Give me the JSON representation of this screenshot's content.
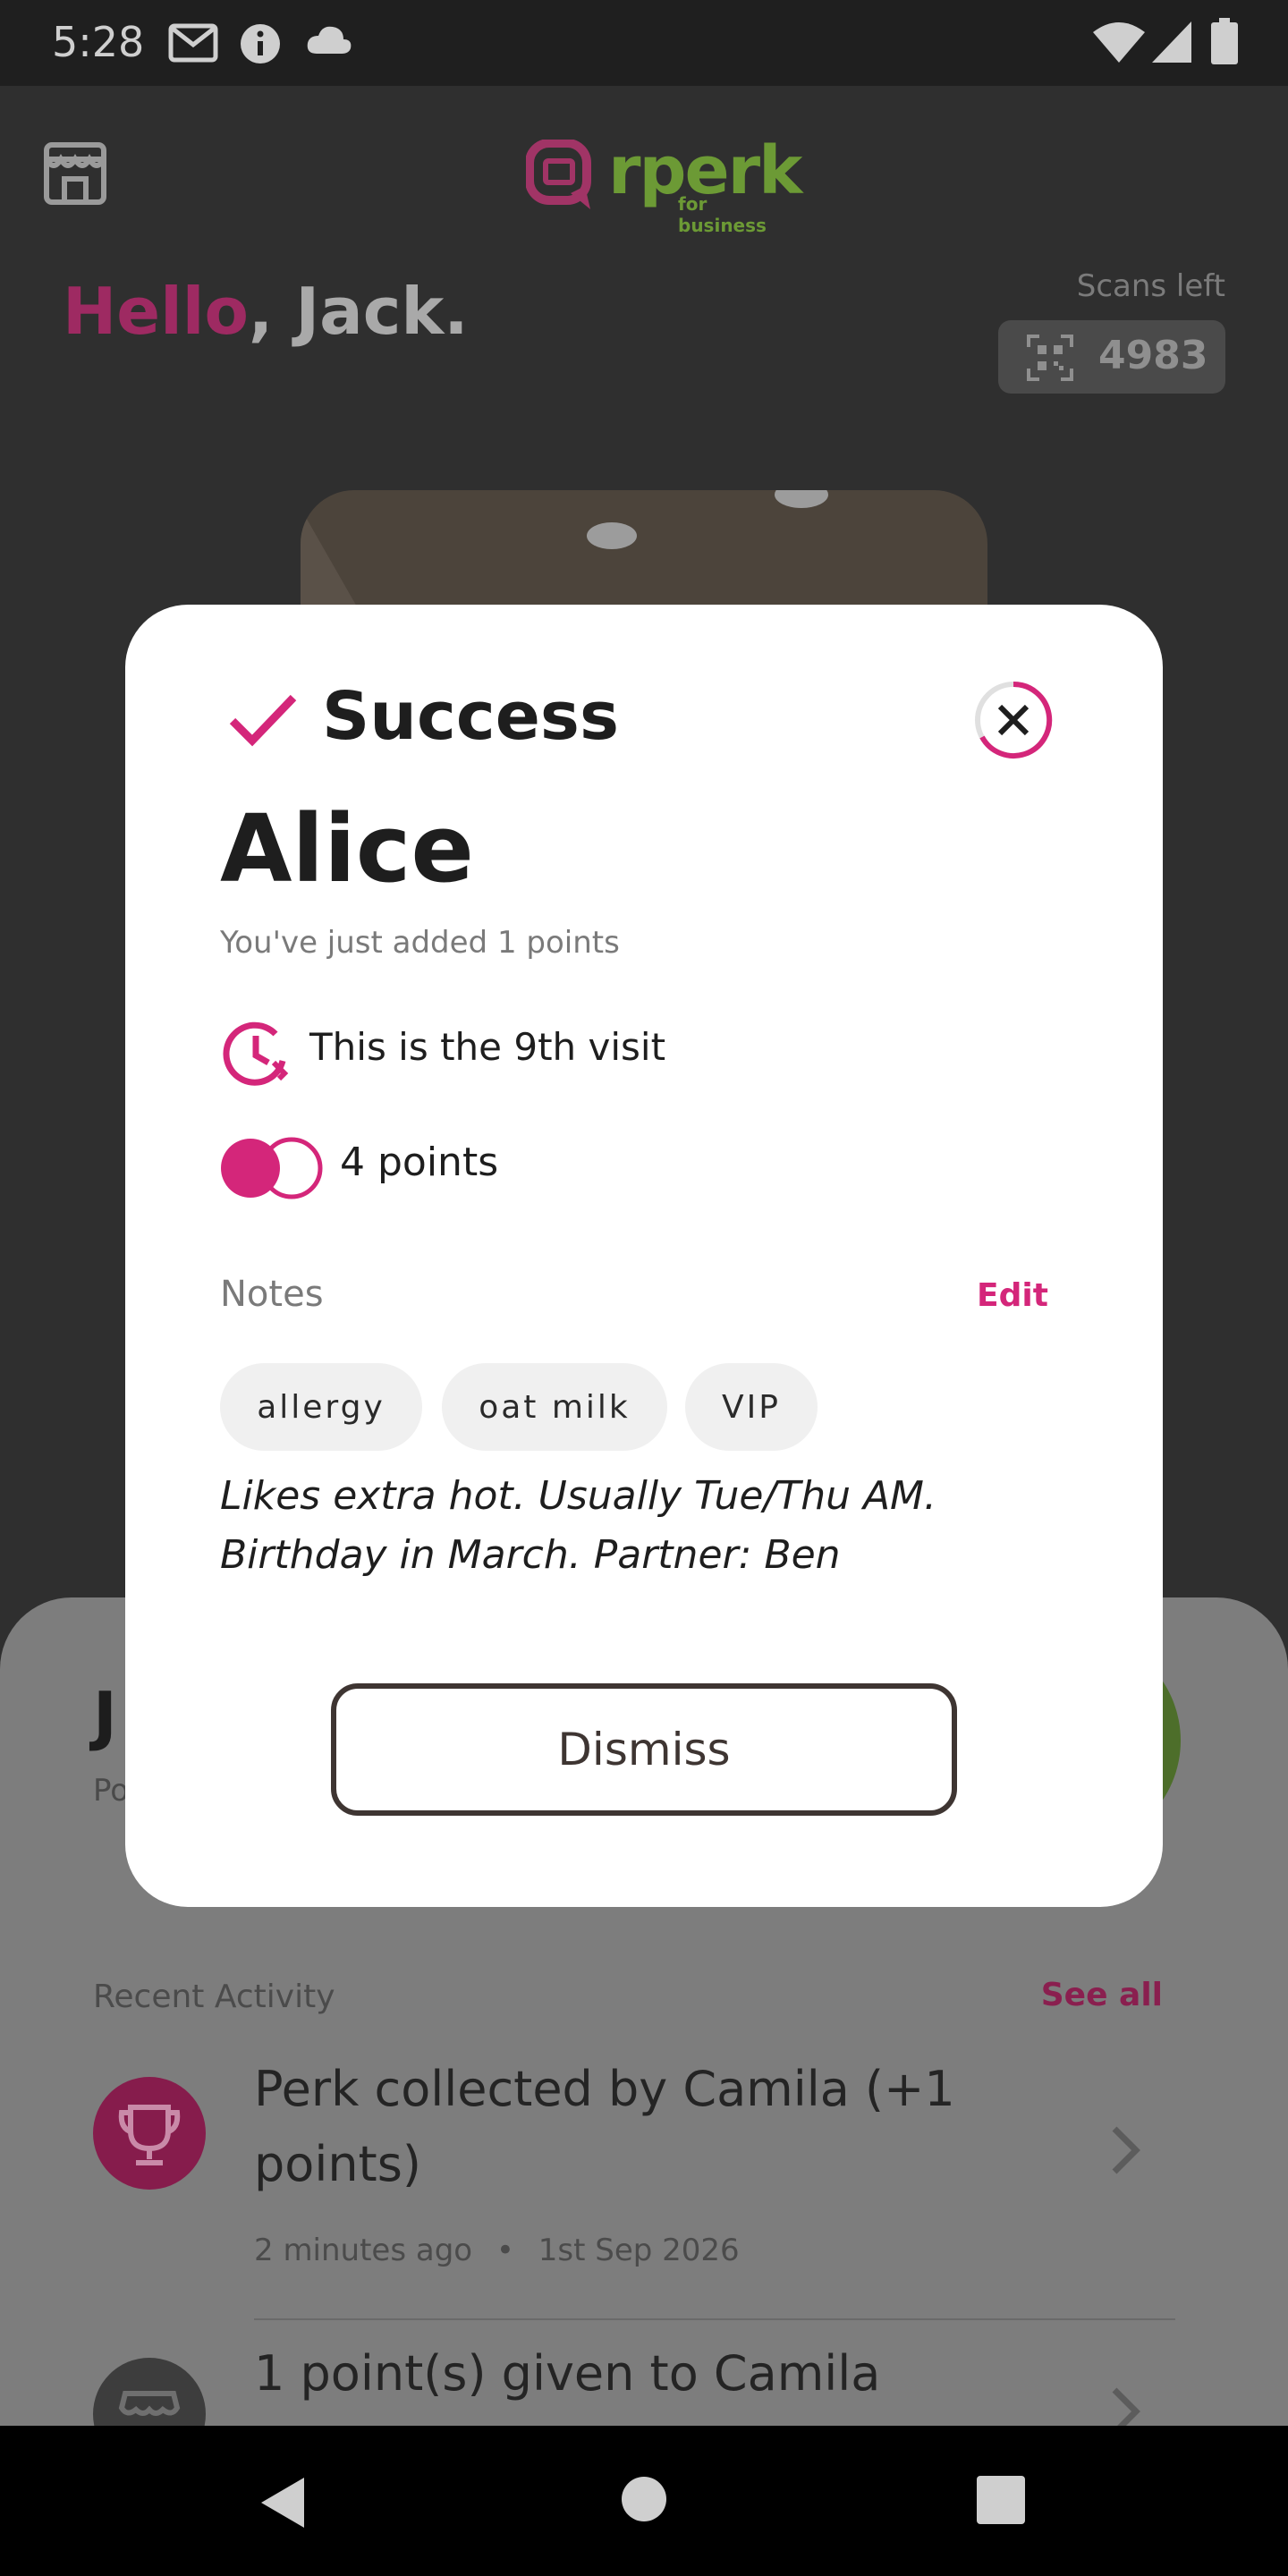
{
  "status_bar": {
    "time": "5:28",
    "icons": [
      "gmail-icon",
      "info-icon",
      "cloud-icon",
      "wifi-icon",
      "signal-icon",
      "battery-icon"
    ]
  },
  "header": {
    "logo_word": "rperk",
    "logo_sub": "for business",
    "greeting_hello": "Hello",
    "greeting_rest": ", Jack.",
    "scans_label": "Scans left",
    "scans_count": "4983"
  },
  "sheet": {
    "user_initial": "J",
    "user_sub": "Po",
    "recent_label": "Recent Activity",
    "see_all": "See all",
    "activities": [
      {
        "title": "Perk collected by Camila (+1 points)",
        "time": "2 minutes ago",
        "date": "1st Sep 2026",
        "icon": "trophy-icon"
      },
      {
        "title": "1 point(s) given to Camila",
        "icon": "store-icon"
      }
    ]
  },
  "modal": {
    "title": "Success",
    "name": "Alice",
    "added_text": "You've just added 1 points",
    "visit_text": "This is the 9th visit",
    "points_text": "4 points",
    "notes_label": "Notes",
    "edit_label": "Edit",
    "tags": [
      "allergy",
      "oat milk",
      "VIP"
    ],
    "notes_text": "Likes extra hot. Usually Tue/Thu AM. Birthday in March. Partner: Ben",
    "dismiss_label": "Dismiss"
  },
  "colors": {
    "accent": "#d4267a",
    "brand_green": "#6c9a35",
    "dismiss_border": "#3e3532"
  }
}
